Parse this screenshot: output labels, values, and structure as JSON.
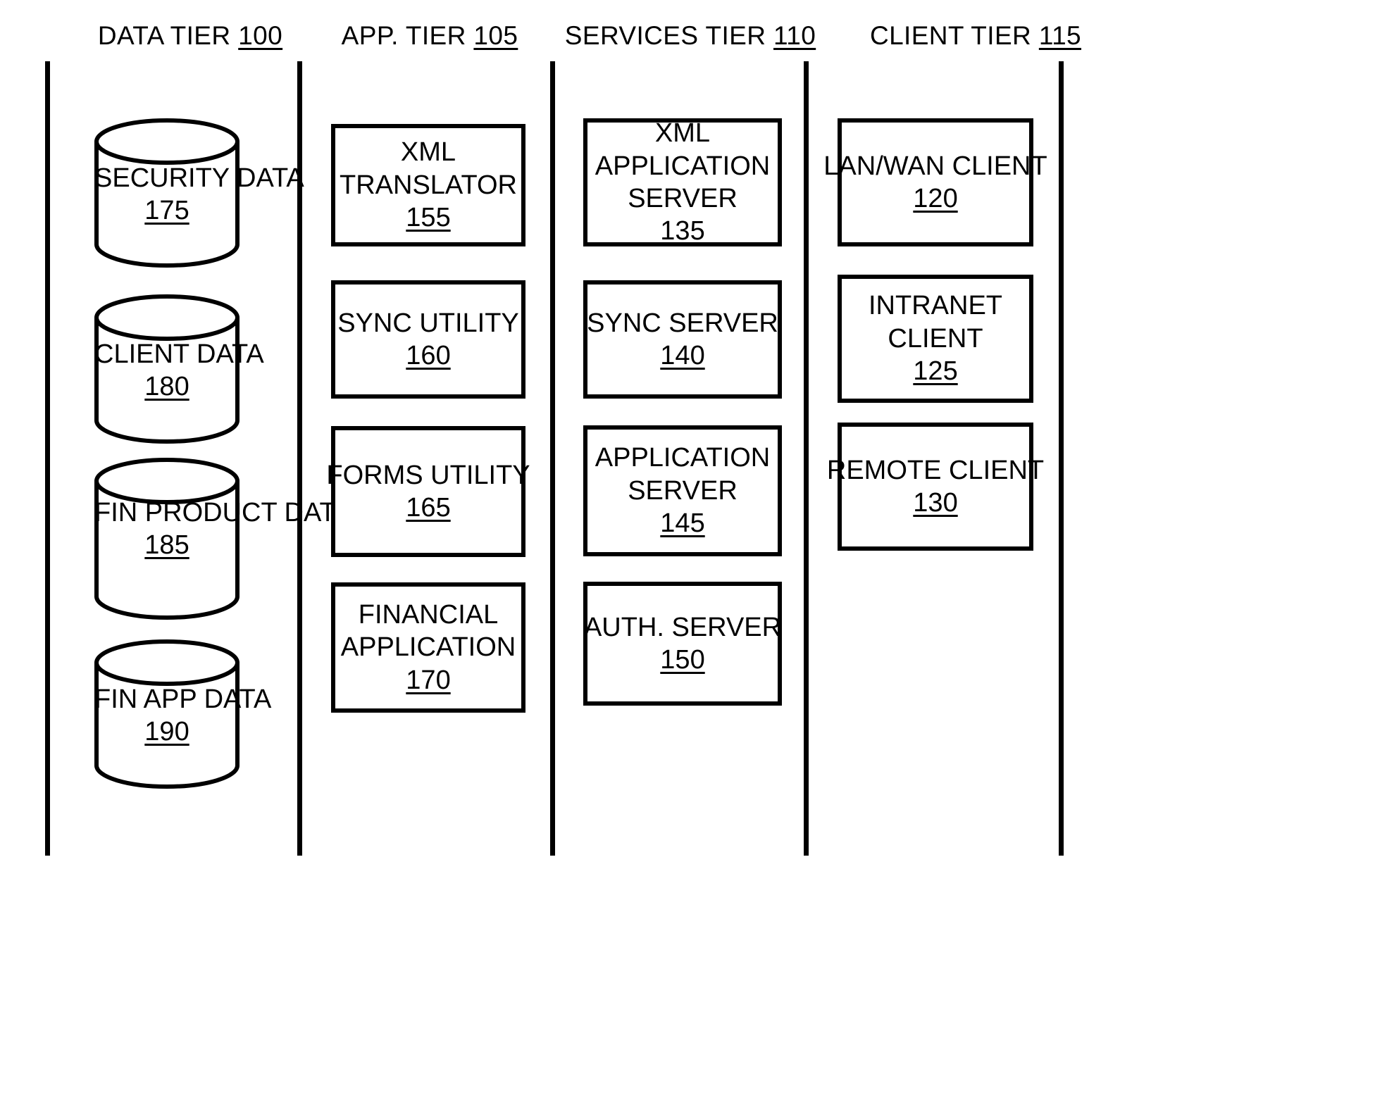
{
  "diagram": {
    "type": "four-tier-architecture-block-diagram",
    "stroke_color": "#000000",
    "background_color": "#ffffff",
    "columns": [
      {
        "id": "data-tier",
        "header_title": "DATA TIER",
        "header_number": "100",
        "node_shape": "cylinder",
        "nodes": [
          {
            "id": "security-data",
            "lines": [
              "SECURITY",
              "DATA"
            ],
            "number": "175"
          },
          {
            "id": "client-data",
            "lines": [
              "CLIENT",
              "DATA"
            ],
            "number": "180"
          },
          {
            "id": "fin-product-data",
            "lines": [
              "FIN",
              "PRODUCT",
              "DATA"
            ],
            "number": "185"
          },
          {
            "id": "fin-app-data",
            "lines": [
              "FIN APP",
              "DATA"
            ],
            "number": "190"
          }
        ]
      },
      {
        "id": "app-tier",
        "header_title": "APP. TIER",
        "header_number": "105",
        "node_shape": "rectangle",
        "nodes": [
          {
            "id": "xml-translator",
            "lines": [
              "XML",
              "TRANSLATOR"
            ],
            "number": "155"
          },
          {
            "id": "sync-utility",
            "lines": [
              "SYNC UTILITY"
            ],
            "number": "160"
          },
          {
            "id": "forms-utility",
            "lines": [
              "FORMS UTILITY"
            ],
            "number": "165"
          },
          {
            "id": "financial-application",
            "lines": [
              "FINANCIAL",
              "APPLICATION"
            ],
            "number": "170"
          }
        ]
      },
      {
        "id": "services-tier",
        "header_title": "SERVICES TIER",
        "header_number": "110",
        "node_shape": "rectangle",
        "nodes": [
          {
            "id": "xml-application-server",
            "lines": [
              "XML",
              "APPLICATION",
              "SERVER"
            ],
            "number": "135"
          },
          {
            "id": "sync-server",
            "lines": [
              "SYNC SERVER"
            ],
            "number": "140"
          },
          {
            "id": "application-server",
            "lines": [
              "APPLICATION",
              "SERVER"
            ],
            "number": "145"
          },
          {
            "id": "auth-server",
            "lines": [
              "AUTH. SERVER"
            ],
            "number": "150"
          }
        ]
      },
      {
        "id": "client-tier",
        "header_title": "CLIENT TIER",
        "header_number": "115",
        "node_shape": "rectangle",
        "nodes": [
          {
            "id": "lan-wan-client",
            "lines": [
              "LAN/WAN CLIENT"
            ],
            "number": "120"
          },
          {
            "id": "intranet-client",
            "lines": [
              "INTRANET",
              "CLIENT"
            ],
            "number": "125"
          },
          {
            "id": "remote-client",
            "lines": [
              "REMOTE CLIENT"
            ],
            "number": "130"
          }
        ]
      }
    ]
  }
}
